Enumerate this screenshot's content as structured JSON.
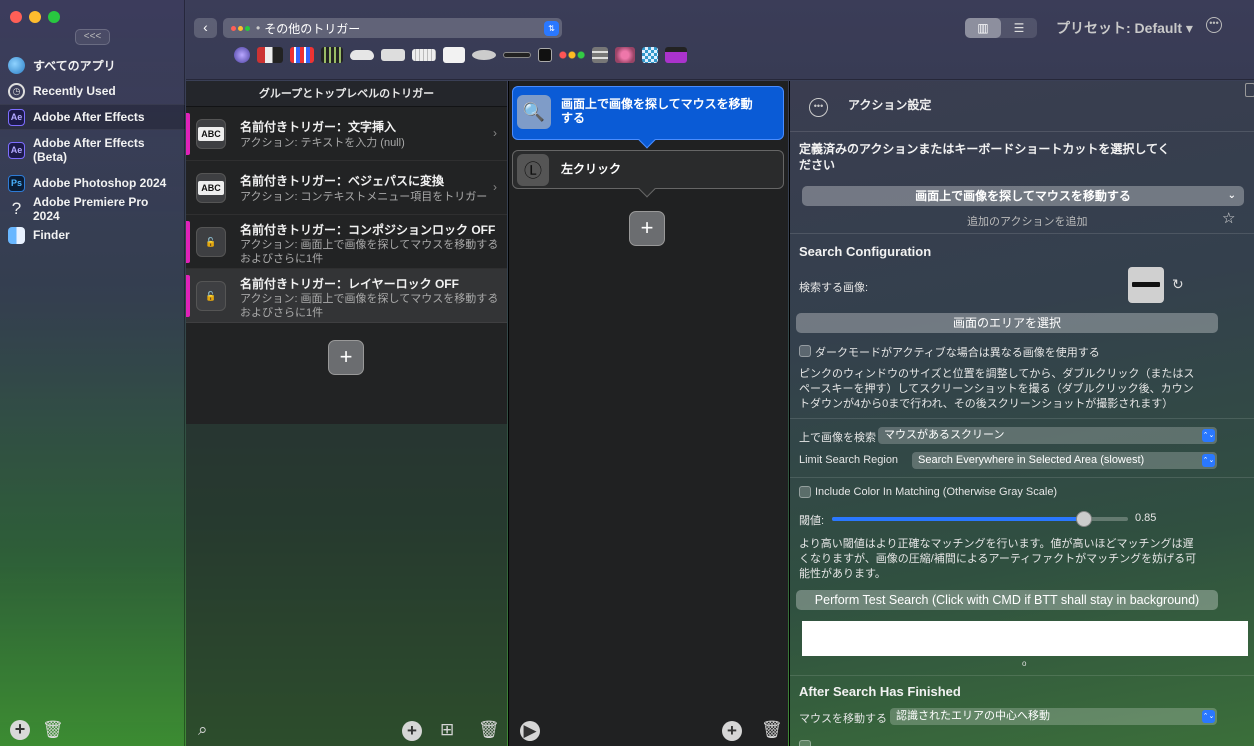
{
  "window": {
    "traffic_lights": [
      "#ff5f57",
      "#febc2e",
      "#28c840"
    ],
    "collapse_label": "<<<"
  },
  "sidebar": {
    "items": [
      {
        "label": "すべてのアプリ",
        "icon": "globe-icon"
      },
      {
        "label": "Recently Used",
        "icon": "clock-icon"
      },
      {
        "label": "Adobe After Effects",
        "icon": "after-effects-icon",
        "selected": true
      },
      {
        "label": "Adobe After Effects (Beta)",
        "icon": "after-effects-icon"
      },
      {
        "label": "Adobe Photoshop 2024",
        "icon": "photoshop-icon"
      },
      {
        "label": "Adobe Premiere Pro 2024",
        "icon": "question-mark-icon"
      },
      {
        "label": "Finder",
        "icon": "finder-icon"
      }
    ],
    "icon_text": {
      "ae": "Ae",
      "ps": "Ps",
      "q": "?"
    },
    "add_label": "+",
    "trash_label": "🗑"
  },
  "toolbar": {
    "back_label": "‹",
    "trigger_group": "その他のトリガー",
    "view_grid_label": "▥",
    "view_list_label": "☰",
    "preset_label": "プリセット: Default ▾",
    "more_label": "•••",
    "trigger_type_icons": [
      "touch-bar-icon",
      "keyboard-icon",
      "touch-bar-strip-icon",
      "key-grid-icon",
      "magic-mouse-icon",
      "trackpad-icon",
      "keyboard-white-icon",
      "remote-icon",
      "mouse-icon",
      "midi-icon",
      "stream-deck-icon",
      "window-buttons-icon",
      "button-grid-icon",
      "shortcut-icon",
      "app-icon",
      "tab-icon"
    ]
  },
  "triggers": {
    "header": "グループとトップレベルのトリガー",
    "items": [
      {
        "title": "名前付きトリガー：文字挿入",
        "sub": "アクション: テキストを入力 (null)",
        "icon": "abc-icon",
        "icon_text": "ABC"
      },
      {
        "title": "名前付きトリガー：ベジェパスに変換",
        "sub": "アクション: コンテキストメニュー項目をトリガー",
        "icon": "abc-icon",
        "icon_text": "ABC"
      },
      {
        "title": "名前付きトリガー：コンポジションロック OFF",
        "sub": "アクション: 画面上で画像を探してマウスを移動する",
        "sub2": "およびさらに1件",
        "icon": "lock-icon",
        "icon_text": "🔓"
      },
      {
        "title": "名前付きトリガー：レイヤーロック OFF",
        "sub": "アクション: 画面上で画像を探してマウスを移動する",
        "sub2": "およびさらに1件",
        "icon": "lock-icon",
        "icon_text": "🔓",
        "selected": true
      }
    ],
    "add_label": "+",
    "footer": {
      "search": "⌕",
      "add": "+",
      "add_folder": "⊞",
      "trash": "🗑"
    }
  },
  "actions": {
    "items": [
      {
        "label": "画面上で画像を探してマウスを移動する",
        "icon": "magnifier-icon",
        "icon_text": "🔍",
        "selected": true
      },
      {
        "label": "左クリック",
        "icon": "left-click-icon",
        "icon_text": "Ⓛ"
      }
    ],
    "add_label": "+",
    "footer": {
      "play": "▶",
      "add": "+",
      "trash": "🗑"
    }
  },
  "settings": {
    "header_icon_label": "•••",
    "title": "アクション設定",
    "choose_label": "定義済みのアクションまたはキーボードショートカットを選択してください",
    "action_dropdown": "画面上で画像を探してマウスを移動する",
    "dropdown_caret": "⌄",
    "add_more": "追加のアクションを追加",
    "star": "☆",
    "search_config_title": "Search Configuration",
    "image_label": "検索する画像:",
    "refresh_icon": "↻",
    "select_area_button": "画面のエリアを選択",
    "dark_mode_label": "ダークモードがアクティブな場合は異なる画像を使用する",
    "instructions": "ピンクのウィンドウのサイズと位置を調整してから、ダブルクリック（またはスペースキーを押す）してスクリーンショットを撮る（ダブルクリック後、カウントダウンが4から0まで行われ、その後スクリーンショットが撮影されます）",
    "search_on_label": "上で画像を検索",
    "search_on_value": "マウスがあるスクリーン",
    "limit_region_label": "Limit Search Region",
    "limit_region_value": "Search Everywhere in Selected Area (slowest)",
    "include_color_label": "Include Color In Matching (Otherwise Gray Scale)",
    "threshold_label": "閾値:",
    "threshold_value": "0.85",
    "threshold_fraction": 0.85,
    "threshold_desc": "より高い閾値はより正確なマッチングを行います。値が高いほどマッチングは遅くなりますが、画像の圧縮/補間によるアーティファクトがマッチングを妨げる可能性があります。",
    "test_button": "Perform Test Search (Click with CMD if BTT shall stay in background)",
    "page_indicator": "o",
    "after_search_title": "After Search Has Finished",
    "move_mouse_label": "マウスを移動する",
    "move_mouse_value": "認識されたエリアの中心へ移動",
    "arrow_glyph": "⌃⌄",
    "accent": "#2a78ff"
  }
}
